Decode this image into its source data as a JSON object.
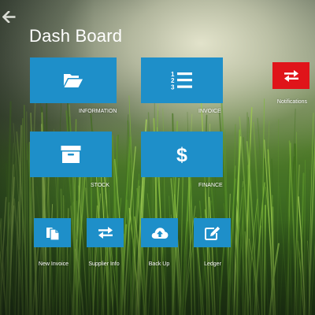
{
  "header": {
    "back_icon": "arrow-left-icon",
    "title": "Dash Board"
  },
  "tiles": {
    "information": {
      "label": "INFORMATION",
      "icon": "folder-open-icon",
      "color": "#1e8fc9"
    },
    "invoice": {
      "label": "INVOICE",
      "icon": "numbered-list-icon",
      "color": "#1e8fc9"
    },
    "notifications": {
      "label": "Notifications",
      "icon": "exchange-arrows-icon",
      "color": "#e0141a"
    },
    "stock": {
      "label": "STOCK",
      "icon": "archive-box-icon",
      "color": "#1e8fc9"
    },
    "finance": {
      "label": "FINANCE",
      "icon": "dollar-icon",
      "color": "#1e8fc9"
    },
    "new_invoice": {
      "label": "New Invoice",
      "icon": "copy-documents-icon",
      "color": "#1e8fc9"
    },
    "supplier_info": {
      "label": "Supplier Info",
      "icon": "exchange-arrows-icon",
      "color": "#1e8fc9"
    },
    "back_up": {
      "label": "Back Up",
      "icon": "cloud-upload-icon",
      "color": "#1e8fc9"
    },
    "ledger": {
      "label": "Ledger",
      "icon": "edit-pencil-icon",
      "color": "#1e8fc9"
    }
  }
}
